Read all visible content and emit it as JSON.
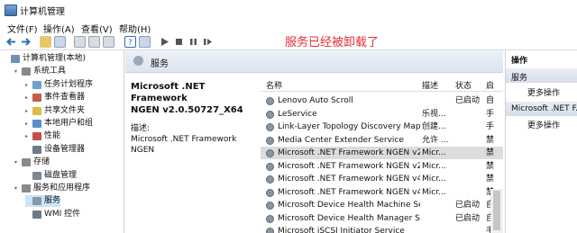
{
  "window": {
    "title": "计算机管理"
  },
  "menu": [
    {
      "label": "文件(F)"
    },
    {
      "label": "操作(A)"
    },
    {
      "label": "查看(V)"
    },
    {
      "label": "帮助(H)"
    }
  ],
  "overlay_message": "服务已经被卸载了",
  "tree": [
    {
      "label": "计算机管理(本地)",
      "level": 0,
      "twisty": "",
      "icon": "computer-icon",
      "color": "#6f8fb5"
    },
    {
      "label": "系统工具",
      "level": 1,
      "twisty": "▾",
      "icon": "tools-icon",
      "color": "#8a8a8a"
    },
    {
      "label": "任务计划程序",
      "level": 2,
      "twisty": "▸",
      "icon": "clock-icon",
      "color": "#6e9fd1"
    },
    {
      "label": "事件查看器",
      "level": 2,
      "twisty": "▸",
      "icon": "log-icon",
      "color": "#c45c4b"
    },
    {
      "label": "共享文件夹",
      "level": 2,
      "twisty": "▸",
      "icon": "folder-icon",
      "color": "#e2b94a"
    },
    {
      "label": "本地用户和组",
      "level": 2,
      "twisty": "▸",
      "icon": "users-icon",
      "color": "#5b8fc7"
    },
    {
      "label": "性能",
      "level": 2,
      "twisty": "▸",
      "icon": "chart-icon",
      "color": "#c05050"
    },
    {
      "label": "设备管理器",
      "level": 2,
      "twisty": "",
      "icon": "device-icon",
      "color": "#6c7a89"
    },
    {
      "label": "存储",
      "level": 1,
      "twisty": "▾",
      "icon": "storage-icon",
      "color": "#8a8a8a"
    },
    {
      "label": "磁盘管理",
      "level": 2,
      "twisty": "",
      "icon": "disk-icon",
      "color": "#7c8794"
    },
    {
      "label": "服务和应用程序",
      "level": 1,
      "twisty": "▾",
      "icon": "services-apps-icon",
      "color": "#8a8a8a"
    },
    {
      "label": "服务",
      "level": 2,
      "twisty": "",
      "icon": "gear-icon",
      "color": "#8a96a6",
      "selected": true
    },
    {
      "label": "WMI 控件",
      "level": 2,
      "twisty": "",
      "icon": "wmi-icon",
      "color": "#6c7a89"
    }
  ],
  "panel": {
    "title": "服务"
  },
  "detail": {
    "name_line1": "Microsoft .NET Framework",
    "name_line2": "NGEN v2.0.50727_X64",
    "desc_label": "描述:",
    "desc_text": "Microsoft .NET Framework NGEN"
  },
  "columns": [
    {
      "label": "名称"
    },
    {
      "label": "描述"
    },
    {
      "label": "状态"
    },
    {
      "label": "启"
    }
  ],
  "services": [
    {
      "name": "Lenovo Auto Scroll",
      "desc": "",
      "status": "已启动",
      "start": "自"
    },
    {
      "name": "LeService",
      "desc": "乐视...",
      "status": "",
      "start": "手"
    },
    {
      "name": "Link-Layer Topology Discovery Map...",
      "desc": "创建...",
      "status": "",
      "start": "手"
    },
    {
      "name": "Media Center Extender Service",
      "desc": "允许 ...",
      "status": "",
      "start": "禁"
    },
    {
      "name": "Microsoft .NET Framework NGEN v2....",
      "desc": "Micr...",
      "status": "",
      "start": "禁",
      "selected": true
    },
    {
      "name": "Microsoft .NET Framework NGEN v2....",
      "desc": "Micr...",
      "status": "",
      "start": "禁"
    },
    {
      "name": "Microsoft .NET Framework NGEN v4....",
      "desc": "Micr...",
      "status": "",
      "start": "禁"
    },
    {
      "name": "Microsoft .NET Framework NGEN v4....",
      "desc": "Micr...",
      "status": "",
      "start": "禁"
    },
    {
      "name": "Microsoft Device Health Machine Ser...",
      "desc": "",
      "status": "已启动",
      "start": "自"
    },
    {
      "name": "Microsoft Device Health Manager Se...",
      "desc": "",
      "status": "已启动",
      "start": "自"
    },
    {
      "name": "Microsoft iSCSI Initiator Service",
      "desc": "",
      "status": "",
      "start": "手"
    }
  ],
  "actions": {
    "header": "操作",
    "group1": "服务",
    "more1": "更多操作",
    "group2": "Microsoft .NET F...",
    "more2": "更多操作"
  }
}
